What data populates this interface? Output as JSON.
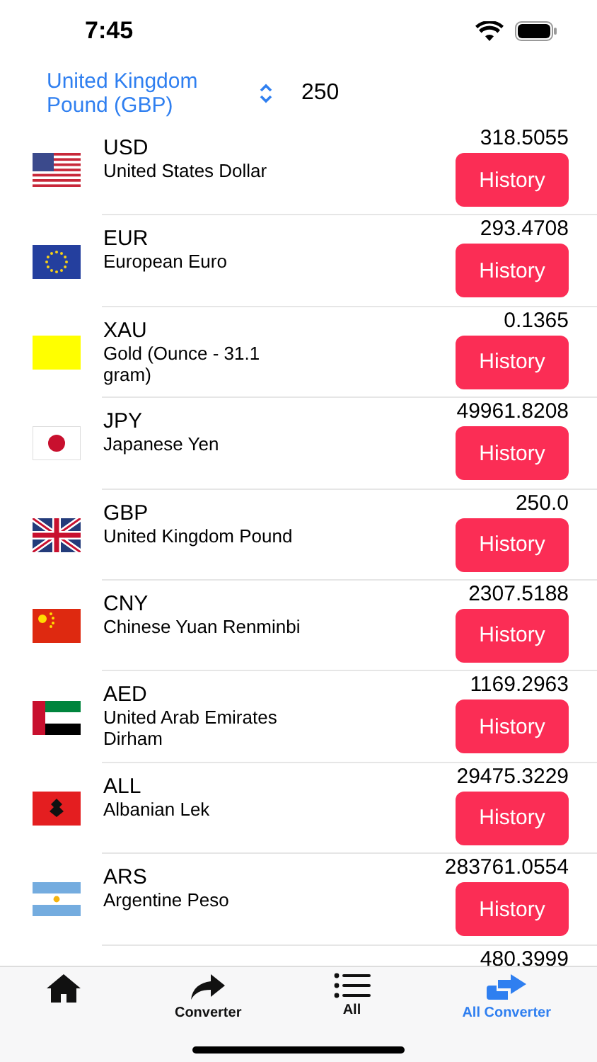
{
  "status_bar": {
    "time": "7:45"
  },
  "header": {
    "currency": "United Kingdom Pound (GBP)",
    "amount": "250"
  },
  "rows": [
    {
      "kind": "us",
      "code": "USD",
      "name": "United States Dollar",
      "value": "318.5055",
      "button": "History"
    },
    {
      "kind": "eu",
      "code": "EUR",
      "name": "European Euro",
      "value": "293.4708",
      "button": "History"
    },
    {
      "kind": "gold",
      "code": "XAU",
      "name": "Gold (Ounce - 31.1 gram)",
      "value": "0.1365",
      "button": "History"
    },
    {
      "kind": "jp",
      "code": "JPY",
      "name": "Japanese Yen",
      "value": "49961.8208",
      "button": "History"
    },
    {
      "kind": "gb",
      "code": "GBP",
      "name": "United Kingdom Pound",
      "value": "250.0",
      "button": "History"
    },
    {
      "kind": "cn",
      "code": "CNY",
      "name": "Chinese Yuan Renminbi",
      "value": "2307.5188",
      "button": "History"
    },
    {
      "kind": "ae",
      "code": "AED",
      "name": "United Arab Emirates Dirham",
      "value": "1169.2963",
      "button": "History"
    },
    {
      "kind": "al",
      "code": "ALL",
      "name": "Albanian Lek",
      "value": "29475.3229",
      "button": "History"
    },
    {
      "kind": "ar",
      "code": "ARS",
      "name": "Argentine Peso",
      "value": "283761.0554",
      "button": "History"
    }
  ],
  "partial_row": {
    "value": "480.3999"
  },
  "tabs": [
    {
      "kind": "home",
      "selected": false
    },
    {
      "kind": "share",
      "label": "Converter",
      "selected": false
    },
    {
      "kind": "list",
      "label": "All",
      "selected": false
    },
    {
      "kind": "double",
      "label": "All Converter",
      "selected": true
    }
  ]
}
